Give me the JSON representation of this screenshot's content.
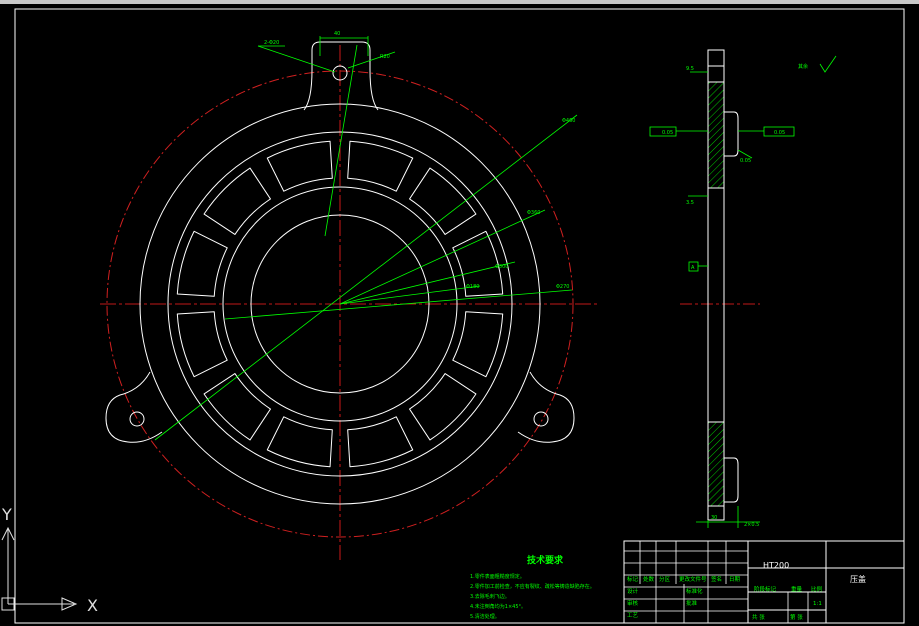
{
  "colors": {
    "background": "#000000",
    "outline": "#ffffff",
    "dimension": "#00ff00",
    "centerline": "#ff2020",
    "hatch": "#00ff00"
  },
  "ucs": {
    "x_label": "X",
    "y_label": "Y"
  },
  "dimensions": {
    "top_left": "2-Φ20",
    "top_width": "40",
    "top_right": "R20",
    "diam_outer": "Φ460",
    "diam_a": "Φ360",
    "diam_b": "Φ300",
    "diam_c": "Φ180",
    "diam_d": "Φ270",
    "side_top": "9.5",
    "side_right": "0.05",
    "side_left": "3.5",
    "side_bottom_a": "30",
    "side_bottom_b": "2×0.5",
    "flatness": "0.05",
    "gdt_left": "0.05",
    "datum": "A",
    "surface": "其余"
  },
  "notes": {
    "title": "技术要求",
    "items": [
      "1.零件表面粗糙度规定。",
      "2.零件加工前检查，不应有裂纹、疏松等铸造缺陷存在。",
      "3.去除毛刺飞边。",
      "4.未注倒角均为1×45°。",
      "5.清洁处理。"
    ]
  },
  "title_block": {
    "material": "HT200",
    "part_name": "压盖",
    "header": [
      "标记",
      "处数",
      "分区",
      "更改文件号",
      "签名",
      "日期"
    ],
    "design": "设计",
    "check": "审核",
    "process": "工艺",
    "standard": "标准化",
    "approve": "批准",
    "stage": "阶段标记",
    "weight": "重量",
    "scale": "比例",
    "scale_value": "1:1",
    "sheet": "共 张",
    "sheet_of": "第 张"
  }
}
